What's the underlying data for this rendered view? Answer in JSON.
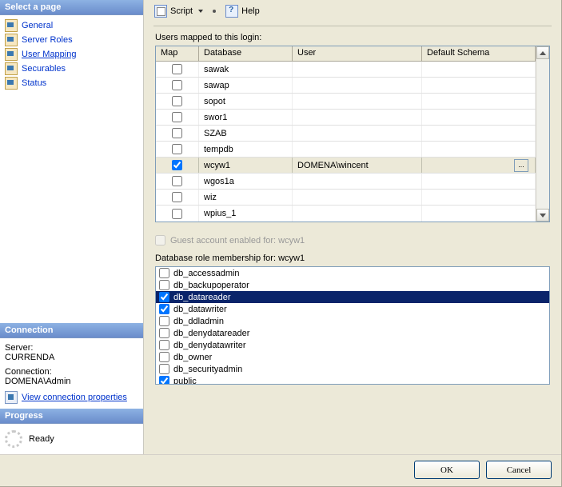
{
  "left": {
    "select_page_header": "Select a page",
    "nav": [
      {
        "label": "General"
      },
      {
        "label": "Server Roles"
      },
      {
        "label": "User Mapping"
      },
      {
        "label": "Securables"
      },
      {
        "label": "Status"
      }
    ],
    "connection_header": "Connection",
    "server_label": "Server:",
    "server_value": "CURRENDA",
    "connection_label": "Connection:",
    "connection_value": "DOMENA\\Admin",
    "view_conn_props": "View connection properties",
    "progress_header": "Progress",
    "progress_status": "Ready"
  },
  "toolbar": {
    "script_label": "Script",
    "help_label": "Help"
  },
  "mapping": {
    "heading": "Users mapped to this login:",
    "columns": {
      "map": "Map",
      "database": "Database",
      "user": "User",
      "schema": "Default Schema"
    },
    "rows": [
      {
        "map": false,
        "database": "sawak",
        "user": "",
        "schema": ""
      },
      {
        "map": false,
        "database": "sawap",
        "user": "",
        "schema": ""
      },
      {
        "map": false,
        "database": "sopot",
        "user": "",
        "schema": ""
      },
      {
        "map": false,
        "database": "swor1",
        "user": "",
        "schema": ""
      },
      {
        "map": false,
        "database": "SZAB",
        "user": "",
        "schema": ""
      },
      {
        "map": false,
        "database": "tempdb",
        "user": "",
        "schema": ""
      },
      {
        "map": true,
        "database": "wcyw1",
        "user": "DOMENA\\wincent",
        "schema": "",
        "selected": true
      },
      {
        "map": false,
        "database": "wgos1a",
        "user": "",
        "schema": ""
      },
      {
        "map": false,
        "database": "wiz",
        "user": "",
        "schema": ""
      },
      {
        "map": false,
        "database": "wpius_1",
        "user": "",
        "schema": ""
      }
    ]
  },
  "guest": {
    "label": "Guest account enabled for: wcyw1"
  },
  "roles": {
    "heading": "Database role membership for: wcyw1",
    "items": [
      {
        "label": "db_accessadmin",
        "checked": false
      },
      {
        "label": "db_backupoperator",
        "checked": false
      },
      {
        "label": "db_datareader",
        "checked": true,
        "selected": true
      },
      {
        "label": "db_datawriter",
        "checked": true
      },
      {
        "label": "db_ddladmin",
        "checked": false
      },
      {
        "label": "db_denydatareader",
        "checked": false
      },
      {
        "label": "db_denydatawriter",
        "checked": false
      },
      {
        "label": "db_owner",
        "checked": false
      },
      {
        "label": "db_securityadmin",
        "checked": false
      },
      {
        "label": "public",
        "checked": true
      }
    ]
  },
  "buttons": {
    "ok": "OK",
    "cancel": "Cancel"
  },
  "misc": {
    "ellipsis": "..."
  }
}
